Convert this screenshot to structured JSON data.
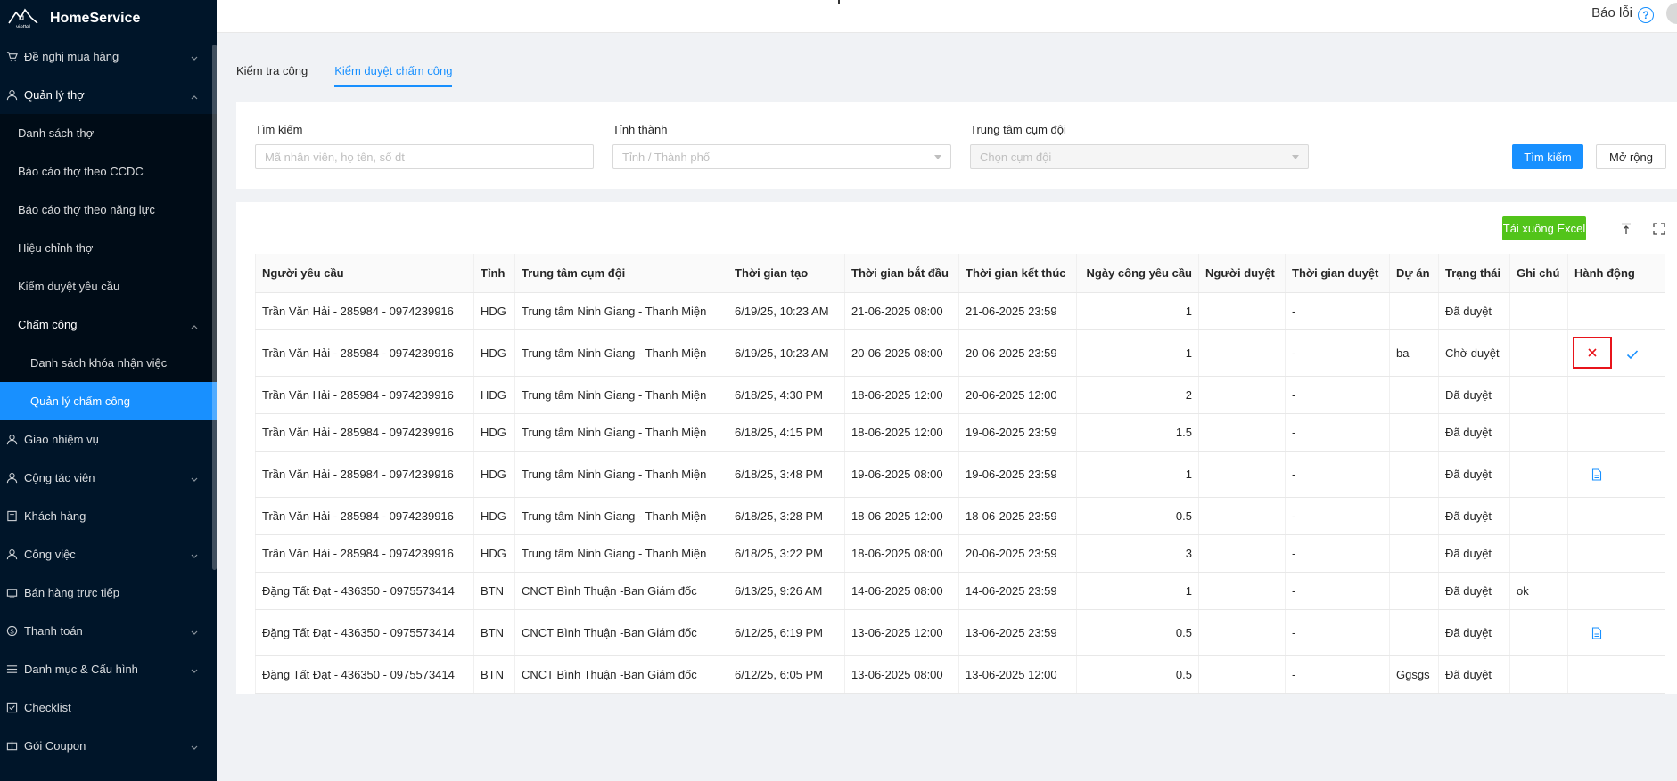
{
  "brand": {
    "name": "HomeService",
    "logo_text": "viettel",
    "logo_sub": "construction"
  },
  "sidebar": {
    "items": [
      {
        "label": "Đề nghị mua hàng",
        "icon": "cart-icon",
        "arrow": "down"
      },
      {
        "label": "Quản lý thợ",
        "icon": "worker-icon",
        "arrow": "up"
      }
    ],
    "sub_items": [
      {
        "label": "Danh sách thợ"
      },
      {
        "label": "Báo cáo thợ theo CCDC"
      },
      {
        "label": "Báo cáo thợ theo năng lực"
      },
      {
        "label": "Hiệu chỉnh thợ"
      },
      {
        "label": "Kiểm duyệt yêu cầu"
      },
      {
        "label": "Chấm công"
      },
      {
        "label": "Danh sách khóa nhận việc"
      },
      {
        "label": "Quản lý chấm công"
      }
    ],
    "rest": [
      {
        "label": "Giao nhiệm vụ",
        "icon": "task-icon"
      },
      {
        "label": "Cộng tác viên",
        "icon": "user-icon"
      },
      {
        "label": "Khách hàng",
        "icon": "customer-icon"
      },
      {
        "label": "Công việc",
        "icon": "work-icon"
      },
      {
        "label": "Bán hàng trực tiếp",
        "icon": "sale-icon"
      },
      {
        "label": "Thanh toán",
        "icon": "payment-icon"
      },
      {
        "label": "Danh mục & Cấu hình",
        "icon": "list-icon"
      },
      {
        "label": "Checklist",
        "icon": "checklist-icon"
      },
      {
        "label": "Gói Coupon",
        "icon": "coupon-icon"
      }
    ]
  },
  "header": {
    "report_label": "Báo lỗi",
    "help_glyph": "?"
  },
  "tabs": [
    {
      "label": "Kiểm tra công"
    },
    {
      "label": "Kiểm duyệt chấm công"
    }
  ],
  "filters": {
    "search": {
      "label": "Tìm kiếm",
      "placeholder": "Mã nhân viên, họ tên, số dt"
    },
    "province": {
      "label": "Tỉnh thành",
      "placeholder": "Tỉnh / Thành phố"
    },
    "center": {
      "label": "Trung tâm cụm đội",
      "placeholder": "Chọn cụm đội"
    },
    "search_button": "Tìm kiếm",
    "expand_button": "Mở rộng"
  },
  "toolbar": {
    "excel_button": "Tải xuống Excel"
  },
  "table": {
    "columns": [
      "Người yêu cầu",
      "Tỉnh",
      "Trung tâm cụm đội",
      "Thời gian tạo",
      "Thời gian bắt đầu",
      "Thời gian kết thúc",
      "Ngày công yêu cầu",
      "Người duyệt",
      "Thời gian duyệt",
      "Dự án",
      "Trạng thái",
      "Ghi chú",
      "Hành động"
    ],
    "rows": [
      [
        "Trần Văn Hải - 285984 - 0974239916",
        "HDG",
        "Trung tâm Ninh Giang - Thanh Miện",
        "6/19/25, 10:23 AM",
        "21-06-2025 08:00",
        "21-06-2025 23:59",
        "1",
        "",
        "-",
        "",
        "Đã duyệt",
        "",
        ""
      ],
      [
        "Trần Văn Hải - 285984 - 0974239916",
        "HDG",
        "Trung tâm Ninh Giang - Thanh Miện",
        "6/19/25, 10:23 AM",
        "20-06-2025 08:00",
        "20-06-2025 23:59",
        "1",
        "",
        "-",
        "ba",
        "Chờ duyệt",
        "",
        "approve"
      ],
      [
        "Trần Văn Hải - 285984 - 0974239916",
        "HDG",
        "Trung tâm Ninh Giang - Thanh Miện",
        "6/18/25, 4:30 PM",
        "18-06-2025 12:00",
        "20-06-2025 12:00",
        "2",
        "",
        "-",
        "",
        "Đã duyệt",
        "",
        ""
      ],
      [
        "Trần Văn Hải - 285984 - 0974239916",
        "HDG",
        "Trung tâm Ninh Giang - Thanh Miện",
        "6/18/25, 4:15 PM",
        "18-06-2025 12:00",
        "19-06-2025 23:59",
        "1.5",
        "",
        "-",
        "",
        "Đã duyệt",
        "",
        ""
      ],
      [
        "Trần Văn Hải - 285984 - 0974239916",
        "HDG",
        "Trung tâm Ninh Giang - Thanh Miện",
        "6/18/25, 3:48 PM",
        "19-06-2025 08:00",
        "19-06-2025 23:59",
        "1",
        "",
        "-",
        "",
        "Đã duyệt",
        "",
        "file"
      ],
      [
        "Trần Văn Hải - 285984 - 0974239916",
        "HDG",
        "Trung tâm Ninh Giang - Thanh Miện",
        "6/18/25, 3:28 PM",
        "18-06-2025 12:00",
        "18-06-2025 23:59",
        "0.5",
        "",
        "-",
        "",
        "Đã duyệt",
        "",
        ""
      ],
      [
        "Trần Văn Hải - 285984 - 0974239916",
        "HDG",
        "Trung tâm Ninh Giang - Thanh Miện",
        "6/18/25, 3:22 PM",
        "18-06-2025 08:00",
        "20-06-2025 23:59",
        "3",
        "",
        "-",
        "",
        "Đã duyệt",
        "",
        ""
      ],
      [
        "Đặng Tất Đạt - 436350 - 0975573414",
        "BTN",
        "CNCT Bình Thuận -Ban Giám đốc",
        "6/13/25, 9:26 AM",
        "14-06-2025 08:00",
        "14-06-2025 23:59",
        "1",
        "",
        "-",
        "",
        "Đã duyệt",
        "ok",
        ""
      ],
      [
        "Đặng Tất Đạt - 436350 - 0975573414",
        "BTN",
        "CNCT Bình Thuận -Ban Giám đốc",
        "6/12/25, 6:19 PM",
        "13-06-2025 12:00",
        "13-06-2025 23:59",
        "0.5",
        "",
        "-",
        "",
        "Đã duyệt",
        "",
        "file"
      ],
      [
        "Đặng Tất Đạt - 436350 - 0975573414",
        "BTN",
        "CNCT Bình Thuận -Ban Giám đốc",
        "6/12/25, 6:05 PM",
        "13-06-2025 08:00",
        "13-06-2025 12:00",
        "0.5",
        "",
        "-",
        "Ggsgs",
        "Đã duyệt",
        "",
        ""
      ]
    ]
  },
  "colors": {
    "sidebar_bg": "#001529",
    "primary": "#1890ff",
    "excel_green": "#52c41a",
    "reject_red": "#e8141b"
  }
}
